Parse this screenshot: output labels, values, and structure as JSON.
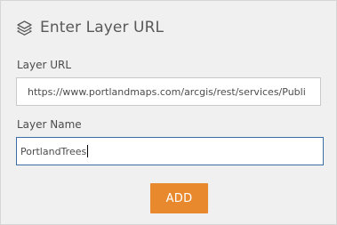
{
  "panel": {
    "title": "Enter Layer URL",
    "icon": "layers-icon"
  },
  "form": {
    "url_label": "Layer URL",
    "url_value": "https://www.portlandmaps.com/arcgis/rest/services/Publi",
    "name_label": "Layer Name",
    "name_value": "PortlandTrees"
  },
  "actions": {
    "add_label": "ADD"
  },
  "colors": {
    "accent": "#e8892e",
    "focus_border": "#3a6ea5",
    "panel_bg": "#f0f0f0"
  }
}
